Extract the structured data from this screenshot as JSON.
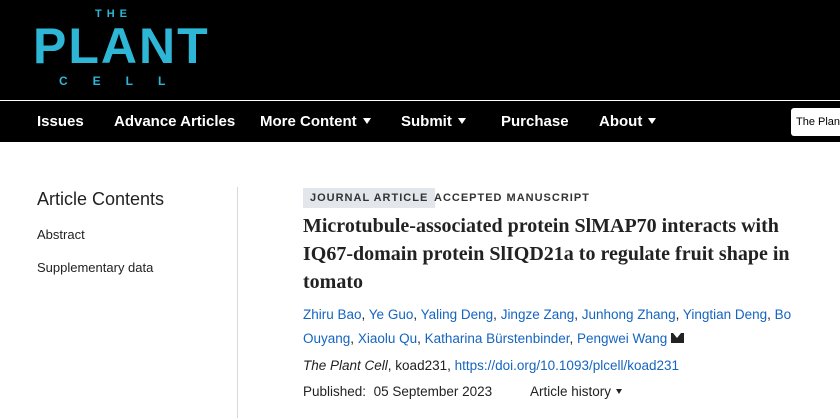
{
  "brand": {
    "logo_the": "THE",
    "logo_plant": "PLANT",
    "logo_cell": "CELL",
    "accent_color": "#2db6d6"
  },
  "nav": {
    "items": [
      {
        "label": "Issues",
        "has_dropdown": false
      },
      {
        "label": "Advance Articles",
        "has_dropdown": false
      },
      {
        "label": "More Content",
        "has_dropdown": true
      },
      {
        "label": "Submit",
        "has_dropdown": true
      },
      {
        "label": "Purchase",
        "has_dropdown": false
      },
      {
        "label": "About",
        "has_dropdown": true
      }
    ],
    "search_text": "The Plant"
  },
  "sidebar": {
    "title": "Article Contents",
    "links": [
      "Abstract",
      "Supplementary data"
    ]
  },
  "article": {
    "type_badge": "JOURNAL ARTICLE",
    "status": "ACCEPTED MANUSCRIPT",
    "title_lines": [
      "Microtubule-associated protein SlMAP70 interacts with",
      "IQ67-domain protein SlIQD21a to regulate fruit shape in",
      "tomato"
    ],
    "authors": [
      "Zhiru Bao",
      "Ye Guo",
      "Yaling Deng",
      "Jingze Zang",
      "Junhong Zhang",
      "Yingtian Deng",
      "Bo Ouyang",
      "Xiaolu Qu",
      "Katharina Bürstenbinder",
      "Pengwei Wang"
    ],
    "citation": {
      "journal": "The Plant Cell",
      "id": ", koad231, ",
      "doi": "https://doi.org/10.1093/plcell/koad231"
    },
    "published_label": "Published:",
    "published_date": "05 September 2023",
    "history_label": "Article history",
    "link_color": "#1565c0"
  }
}
